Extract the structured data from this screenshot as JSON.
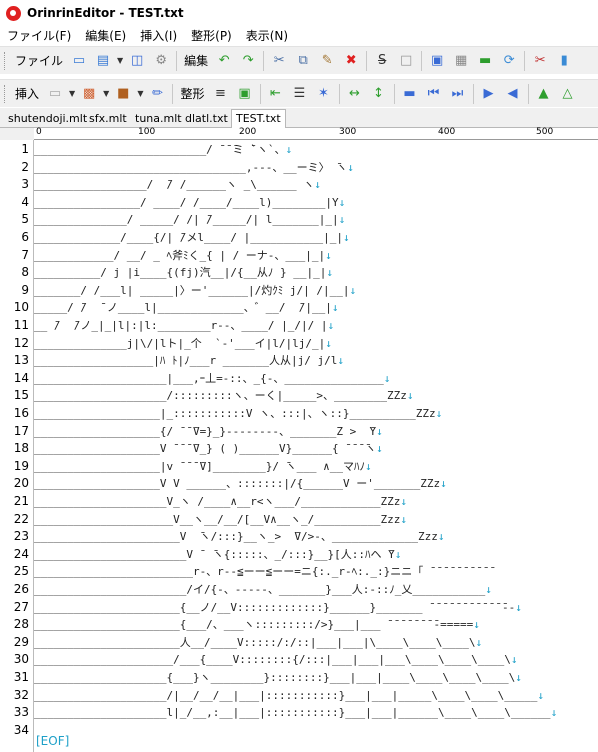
{
  "window": {
    "title": "OrinrinEditor - TEST.txt"
  },
  "menu": [
    "ファイル(F)",
    "編集(E)",
    "挿入(I)",
    "整形(P)",
    "表示(N)"
  ],
  "toolbar1": {
    "file_label": "ファイル",
    "edit_label": "編集"
  },
  "toolbar2": {
    "insert_label": "挿入",
    "format_label": "整形"
  },
  "tabs": [
    "shutendoji.mlt",
    "sfx.mlt",
    "tuna.mlt",
    "dlatl.txt",
    "TEST.txt"
  ],
  "active_tab": "TEST.txt",
  "ruler": [
    "0",
    "100",
    "200",
    "300",
    "400",
    "500"
  ],
  "line_numbers": [
    "1",
    "2",
    "3",
    "4",
    "5",
    "6",
    "7",
    "8",
    "9",
    "10",
    "11",
    "12",
    "13",
    "14",
    "15",
    "16",
    "17",
    "18",
    "19",
    "20",
    "21",
    "22",
    "23",
    "24",
    "25",
    "26",
    "27",
    "28",
    "29",
    "30",
    "31",
    "32",
    "33",
    "34"
  ],
  "lines": [
    "__________________________/ ̄ ̄ ̄ミ ̄`ヽ`、↓",
    "________________________________,-‐-、__ーミ〉 ̄ヽ↓",
    "_________________/  ̄/ /______ヽ _\\______ ヽ↓",
    "________________/ ____/ /____/____l)________|Y↓",
    "______________/ _____/ /| ̄/_____/| l_______|_|↓",
    "_____________/____{/| ̄/メl____/ |___________|_|↓",
    "____________/ __/ _ ﾍ斧ﾐく_{ | / ーナ-、___|_|↓",
    "__________/ j |i____{(fj)汽__|/{__从ﾉ } __|_|↓",
    "_______/ /___l| _____|〉ー'______|/灼ｸﾐ j/| /|__|↓",
    "_____/ ̄/  ̄ ノ____l|_____________、゛__/  ̄/|__|↓",
    "__ ̄/  ̄/ノ_|_|l|:|l:________r--、____/ |_/|/ |↓",
    "______________j|\\/|lト|_个  `-'___イ|l/|lj/_|↓",
    "__________________|ﾊ ﾄ|ﾉ___r _______人从|j/ j/l↓",
    "____________________|___,ｰ丄=-::、_{-、_______________↓",
    "____________________/:::::::::ヽ、ーく|_____>、________ZZz↓",
    "___________________|_:::::::::::V ヽ、:::|、ヽ::}__________ZZz↓",
    "___________________{/ ̄ ̄ ̄V=}_}--------、_______Z >  ̄Y↓",
    "___________________V ̄ ̄ ̄ ̄V_} ( )______V}______{ ̄ ̄ ̄ ̄ヽ↓",
    "___________________|v ̄ ̄ ̄ ̄V]________}/ ̄ヽ___ ∧__マﾊﾉ↓",
    "___________________V V ______、:::::::|/{______V ー'_______ZZz↓",
    "____________________V_ヽ /____∧__r<ヽ___/____________ZZz↓",
    "_____________________V__ヽ__/__/[__V∧__ヽ_/__________Zzz↓",
    "______________________V  ̄ヽ/:::}__ヽ_>  ̄V/>-、_____________Zzz↓",
    "_______________________V ̄  ̄ヽ{:::::、_/:::}__}[人::ﾊヘ ̄Y↓",
    "________________________r-、r--≦ーー≦ーー=ニ{:._r-ﾍ:._:}ニニ「 ̄ ̄ ̄ ̄ ̄ ̄ ̄ ̄ ̄ ̄",
    "_______________________/イ/{-、-----、_______}___人:-::ﾉ_乂___________↓",
    "______________________{__ノ/__V:::::::::::::}______}_______ ̄ ̄ ̄ ̄ ̄ ̄ ̄ ̄ ̄ ̄ ̄ ̄--↓",
    "______________________{___/、___ヽ:::::::::/>}___|___ ̄ ̄ ̄ ̄ ̄ ̄ ̄ ̄-=====↓",
    "______________________人__/____V:::::/:/::|___|___|\\____\\____\\____\\↓",
    "_____________________/___{____V::::::::{/:::|___|___|___\\____\\____\\____\\↓",
    "____________________{___}ヽ________}::::::::}___|___|____\\____\\____\\____\\↓",
    "____________________/|__/__/__|___|:::::::::::}___|___|_____\\____\\____\\_____↓",
    "____________________l|_/__,:__|___|:::::::::::}___|___|______\\____\\____\\______↓"
  ],
  "eof_marker": "[EOF]"
}
